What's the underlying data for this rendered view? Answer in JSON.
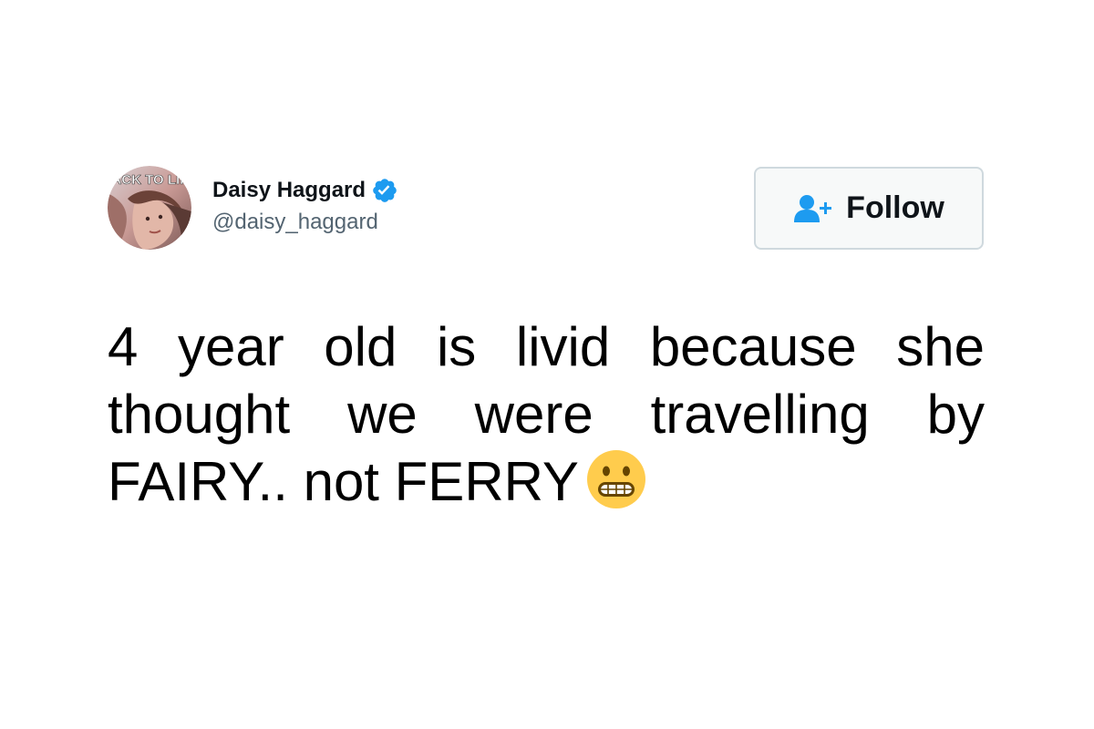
{
  "tweet": {
    "author": {
      "name": "Daisy Haggard",
      "handle": "@daisy_haggard",
      "verified": true,
      "avatar_icon": "avatar-photo",
      "avatar_text": "BACK TO LIFE"
    },
    "follow_button": {
      "label": "Follow",
      "icon": "add-user-icon"
    },
    "text_line_1": "4 year old is livid because she thought we were travelling by FAIRY.. not FERRY",
    "emoji": "grimacing-face-emoji"
  },
  "colors": {
    "text_primary": "#0f1419",
    "text_secondary": "#536471",
    "accent": "#1d9bf0",
    "button_border": "#cfd9de",
    "button_bg": "#f7f9f9",
    "emoji_yellow": "#ffcc4d"
  }
}
